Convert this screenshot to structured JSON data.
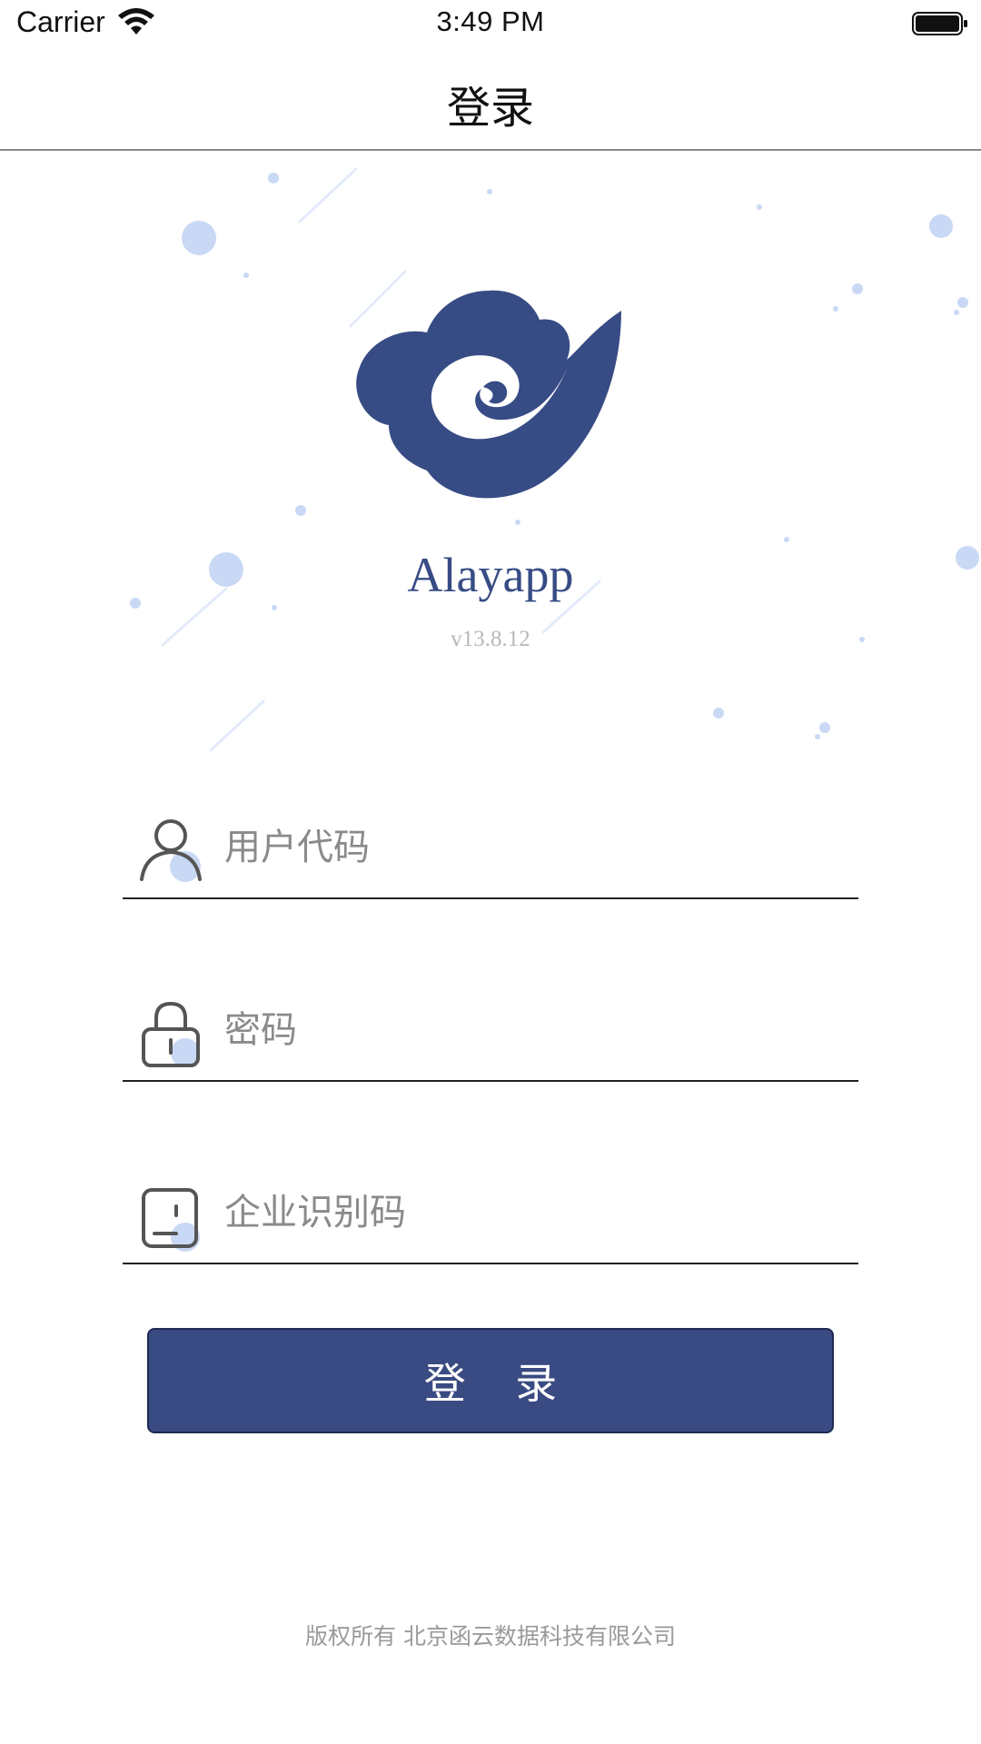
{
  "status_bar": {
    "carrier": "Carrier",
    "time": "3:49 PM"
  },
  "nav": {
    "title": "登录"
  },
  "app": {
    "name": "Alayapp",
    "version": "v13.8.12"
  },
  "form": {
    "user_code": {
      "placeholder": "用户代码",
      "value": "",
      "icon": "user-icon"
    },
    "password": {
      "placeholder": "密码",
      "value": "",
      "icon": "lock-icon"
    },
    "company_code": {
      "placeholder": "企业识别码",
      "value": "",
      "icon": "id-card-icon"
    },
    "login_label": "登 录"
  },
  "footer": {
    "copyright": "版权所有 北京函云数据科技有限公司"
  },
  "colors": {
    "brand": "#374c84",
    "button": "#3a4a82",
    "accent_dot": "#c9d8f5"
  }
}
